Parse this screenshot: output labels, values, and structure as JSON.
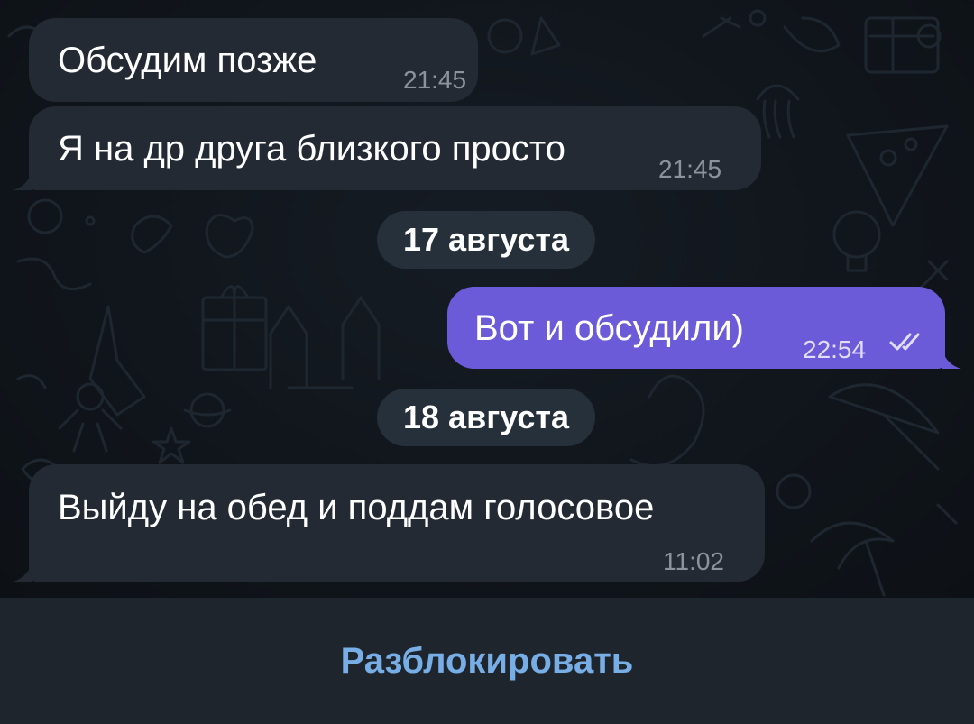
{
  "chat": {
    "messages": [
      {
        "id": "m1",
        "direction": "incoming",
        "text": "Обсудим позже",
        "time": "21:45"
      },
      {
        "id": "m2",
        "direction": "incoming",
        "text": "Я на др друга близкого просто",
        "time": "21:45"
      },
      {
        "id": "m3",
        "direction": "outgoing",
        "text": "Вот и обсудили)",
        "time": "22:54",
        "status": "read"
      },
      {
        "id": "m4",
        "direction": "incoming",
        "text": "Выйду на обед и поддам голосовое",
        "time": "11:02"
      }
    ],
    "date_separators": [
      "17 августа",
      "18 августа"
    ]
  },
  "bottom_bar": {
    "action_label": "Разблокировать"
  },
  "colors": {
    "incoming_bubble": "#242a33",
    "outgoing_bubble": "#6c5bd8",
    "background": "#10151b",
    "accent": "#78aee6"
  },
  "icons": {
    "read_status": "double-check-icon"
  }
}
